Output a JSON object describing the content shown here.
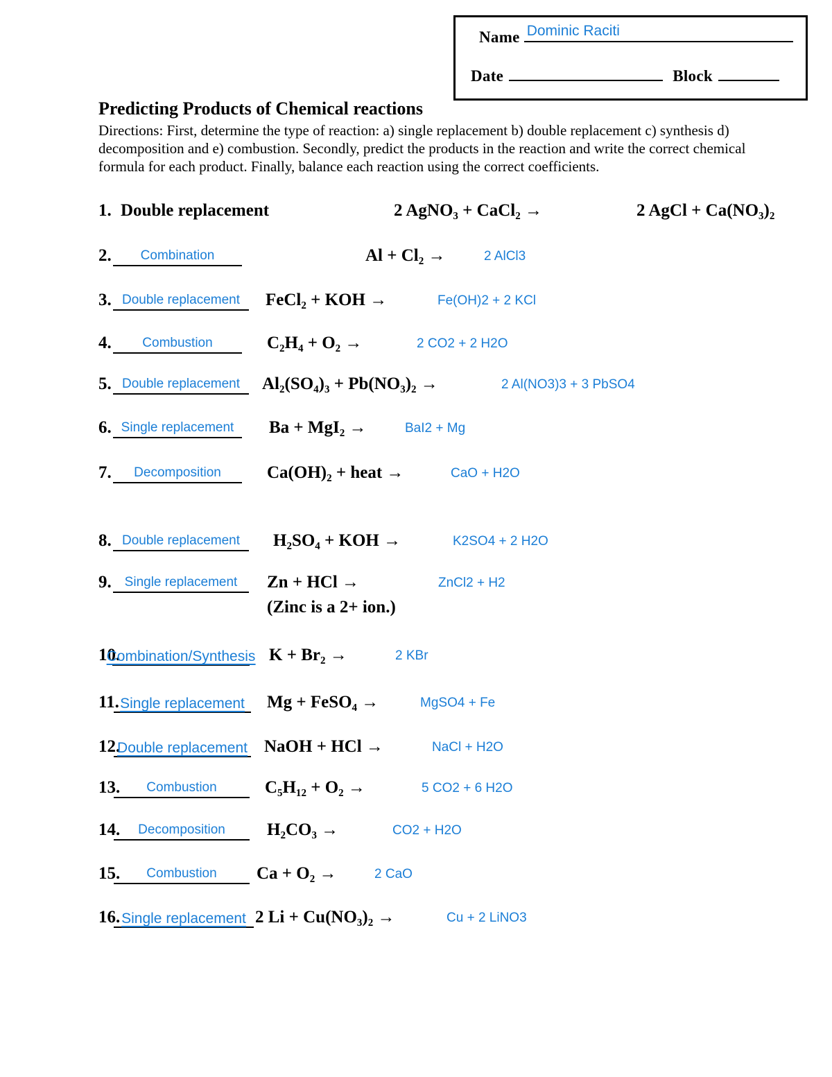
{
  "header": {
    "name_label": "Name",
    "name_value": "Dominic Raciti",
    "date_label": "Date",
    "block_label": "Block"
  },
  "title": "Predicting Products of Chemical reactions",
  "directions": "Directions: First, determine the type of reaction: a) single replacement b) double replacement c) synthesis d) decomposition and e) combustion. Secondly, predict the products in the reaction and write the correct chemical formula for each product. Finally, balance each reaction using the correct coefficients.",
  "ink_color": "#1b7ed6",
  "problems": [
    {
      "number": "1.",
      "type": "Double replacement",
      "printed": true,
      "reactants": "2 AgNO₃  + CaCl₂  →",
      "products": "2 AgCl + Ca(NO₃)₂"
    },
    {
      "number": "2.",
      "type": "Combination",
      "printed": false,
      "on_line": false,
      "reactants": "Al  + Cl₂  →",
      "products": "2 AlCl3"
    },
    {
      "number": "3.",
      "type": "Double replacement",
      "printed": false,
      "on_line": false,
      "reactants": "FeCl₂  + KOH  →",
      "products": "Fe(OH)2 + 2 KCl"
    },
    {
      "number": "4.",
      "type": "Combustion",
      "printed": false,
      "on_line": false,
      "reactants": "C₂H₄  + O₂  →",
      "products": "2 CO2 + 2 H2O"
    },
    {
      "number": "5.",
      "type": "Double replacement",
      "printed": false,
      "on_line": false,
      "reactants": "Al₂(SO₄)₃  + Pb(NO₃)₂  →",
      "products": "2 Al(NO3)3 + 3 PbSO4"
    },
    {
      "number": "6.",
      "type": "Single replacement",
      "printed": false,
      "on_line": false,
      "reactants": "Ba  + MgI₂  →",
      "products": "BaI2 + Mg"
    },
    {
      "number": "7.",
      "type": "Decomposition",
      "printed": false,
      "on_line": false,
      "reactants": "Ca(OH)₂  + heat →",
      "products": "CaO + H2O"
    },
    {
      "number": "8.",
      "type": "Double replacement",
      "printed": false,
      "on_line": false,
      "reactants": "H₂SO₄  + KOH  →",
      "products": "K2SO4 + 2 H2O"
    },
    {
      "number": "9.",
      "type": "Single replacement",
      "printed": false,
      "on_line": false,
      "reactants": "Zn  + HCl  →",
      "reactants_line2": "(Zinc is a 2+ ion.)",
      "products": "ZnCl2 + H2"
    },
    {
      "number": "10.",
      "type": "Combination/Synthesis",
      "printed": false,
      "on_line": true,
      "reactants": "K  + Br₂  →",
      "products": "2 KBr"
    },
    {
      "number": "11.",
      "type": "Single replacement",
      "printed": false,
      "on_line": true,
      "reactants": "Mg  + FeSO₄  →",
      "products": "MgSO4 + Fe"
    },
    {
      "number": "12.",
      "type": "Double replacement",
      "printed": false,
      "on_line": true,
      "reactants": "NaOH  + HCl  →",
      "products": "NaCl + H2O"
    },
    {
      "number": "13.",
      "type": "Combustion",
      "printed": false,
      "on_line": false,
      "reactants": "C₅H₁₂  + O₂  →",
      "products": "5 CO2 + 6 H2O"
    },
    {
      "number": "14.",
      "type": "Decomposition",
      "printed": false,
      "on_line": false,
      "reactants": "H₂CO₃  →",
      "products": "CO2 + H2O"
    },
    {
      "number": "15.",
      "type": "Combustion",
      "printed": false,
      "on_line": false,
      "reactants": "Ca  + O₂  →",
      "products": "2 CaO"
    },
    {
      "number": "16.",
      "type": "Single replacement",
      "printed": false,
      "on_line": true,
      "reactants": "2 Li  + Cu(NO₃)₂  →",
      "products": "Cu + 2 LiNO3"
    }
  ]
}
